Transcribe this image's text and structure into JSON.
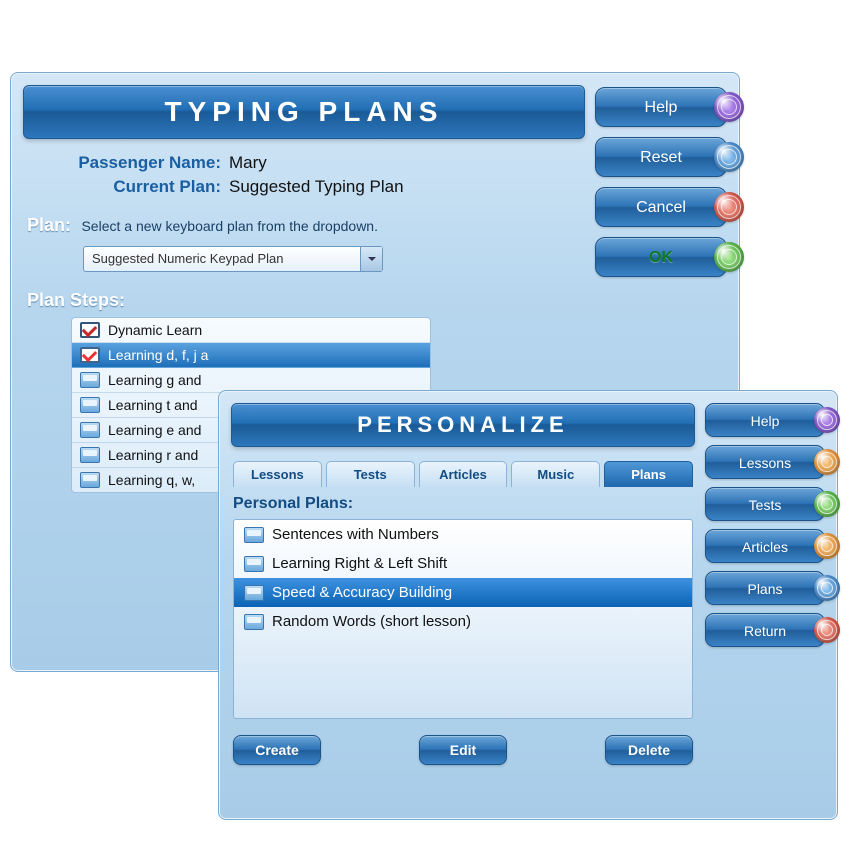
{
  "back": {
    "title": "TYPING PLANS",
    "passenger_label": "Passenger Name:",
    "passenger_value": "Mary",
    "current_plan_label": "Current Plan:",
    "current_plan_value": "Suggested Typing Plan",
    "plan_label": "Plan:",
    "plan_help": "Select a new keyboard plan from the dropdown.",
    "plan_selected": "Suggested Numeric Keypad Plan",
    "steps_label": "Plan Steps:",
    "steps": [
      {
        "label": "Dynamic Learn",
        "icon": "check"
      },
      {
        "label": "Learning d, f, j a",
        "icon": "check",
        "selected": true
      },
      {
        "label": "Learning g and",
        "icon": "screen"
      },
      {
        "label": "Learning t and",
        "icon": "screen"
      },
      {
        "label": "Learning e and",
        "icon": "screen"
      },
      {
        "label": "Learning r and",
        "icon": "screen"
      },
      {
        "label": "Learning q, w, ",
        "icon": "screen"
      }
    ],
    "side": {
      "help": "Help",
      "reset": "Reset",
      "cancel": "Cancel",
      "ok": "OK"
    }
  },
  "front": {
    "title": "PERSONALIZE",
    "tabs": {
      "lessons": "Lessons",
      "tests": "Tests",
      "articles": "Articles",
      "music": "Music",
      "plans": "Plans"
    },
    "plans_header": "Personal Plans:",
    "plans": [
      {
        "label": "Sentences with Numbers"
      },
      {
        "label": "Learning Right & Left Shift"
      },
      {
        "label": "Speed & Accuracy Building",
        "selected": true
      },
      {
        "label": "Random Words (short lesson)"
      }
    ],
    "buttons": {
      "create": "Create",
      "edit": "Edit",
      "delete": "Delete"
    },
    "side": {
      "help": "Help",
      "lessons": "Lessons",
      "tests": "Tests",
      "articles": "Articles",
      "plans": "Plans",
      "return": "Return"
    }
  }
}
